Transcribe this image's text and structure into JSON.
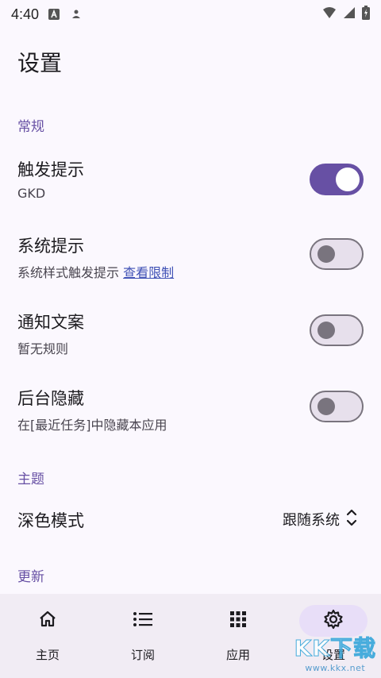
{
  "status_bar": {
    "time": "4:40"
  },
  "page": {
    "title": "设置"
  },
  "sections": {
    "general": "常规",
    "theme": "主题",
    "update": "更新"
  },
  "settings": [
    {
      "title": "触发提示",
      "subtitle": "GKD",
      "enabled": true
    },
    {
      "title": "系统提示",
      "subtitle": "系统样式触发提示",
      "link": "查看限制",
      "enabled": false
    },
    {
      "title": "通知文案",
      "subtitle": "暂无规则",
      "enabled": false
    },
    {
      "title": "后台隐藏",
      "subtitle": "在[最近任务]中隐藏本应用",
      "enabled": false
    }
  ],
  "theme_setting": {
    "label": "深色模式",
    "value": "跟随系统"
  },
  "bottom_nav": [
    {
      "label": "主页",
      "icon": "home-icon",
      "active": false
    },
    {
      "label": "订阅",
      "icon": "list-icon",
      "active": false
    },
    {
      "label": "应用",
      "icon": "apps-grid-icon",
      "active": false
    },
    {
      "label": "设置",
      "icon": "gear-icon",
      "active": true
    }
  ],
  "watermark": {
    "big": "KK下载",
    "small": "www.kkx.net"
  },
  "colors": {
    "accent": "#6750a4",
    "background": "#fbf8fe",
    "nav_background": "#f1ecf4",
    "active_pill": "#e8def8",
    "link": "#3f51b5"
  }
}
